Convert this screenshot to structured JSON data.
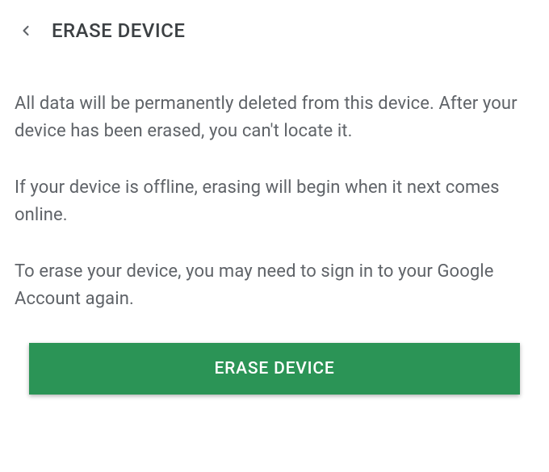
{
  "header": {
    "title": "ERASE DEVICE"
  },
  "content": {
    "paragraph1": "All data will be permanently deleted from this device. After your device has been erased, you can't locate it.",
    "paragraph2": "If your device is offline, erasing will begin when it next comes online.",
    "paragraph3": "To erase your device, you may need to sign in to your Google Account again."
  },
  "button": {
    "label": "ERASE DEVICE"
  },
  "colors": {
    "accent": "#2b9456",
    "text_primary": "#3c4043",
    "text_secondary": "#5f6368"
  }
}
